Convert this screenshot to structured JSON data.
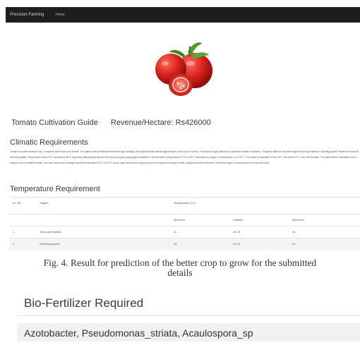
{
  "navbar": {
    "brand": "Precision Farming",
    "link": "Home"
  },
  "hero": {
    "icon": "tomatoes-image"
  },
  "guide": {
    "title": "Tomato Cultivation Guide",
    "revenue": "Revenue/Hectare: Rs426000"
  },
  "climate": {
    "heading": "Climatic Requirements",
    "text": "Tomato is a warm season crop, it requires warm and cool climate. The plants cannot withstand frost and high humidity. Also light intensity affects pigmentation, fruit colour, fruit set. The plant is highly affected by adverse climatic conditions. It requires different climatic range for seed germination, seedling growth, flower and fruit set, and fruit quality. Temperature below 10°C and above 38°C adversely affects plant tissues thereby slow down physiological activities. It thrives well in temperature 10°C to 30°C with optimum range of temperature is 21-24°C. The mean temperature below 16°C and above 27°C are not desirable. The plant doesn't withstand frost, it requires low to medium rainfall, and does well under average monthly temperature of 21 to 23°C. Avoid water stress and long dry period as it causes cracking of fruits. Bright sunshine at the time of fruit set helps to develop dark red coloured fruits."
  },
  "temperature": {
    "heading": "Temperature Requirement",
    "columns": {
      "sr": "Sr. No.",
      "stages": "Stages",
      "group": "Temperature (°C)",
      "minimum": "Minimum",
      "suitable": "Suitable",
      "maximum": "Maximum"
    },
    "rows": [
      {
        "sr": "1.",
        "stage": "Seed germination",
        "min": "11",
        "suitable": "16-29",
        "max": "34"
      },
      {
        "sr": "2.",
        "stage": "Seedling growth",
        "min": "16",
        "suitable": "21-24",
        "max": "32"
      }
    ]
  },
  "caption": {
    "lead": "Fig. 4.",
    "text": " Result for prediction of the better crop to grow for the submitted",
    "line2": "details"
  },
  "biofertilizer": {
    "title": "Bio-Fertilizer Required",
    "value": "Azotobacter, Pseudomonas_striata, Acaulospora_sp"
  },
  "colors": {
    "navbar": "#1e1e1e",
    "tomato": "#d9231d",
    "leaf": "#4f9a2a"
  }
}
